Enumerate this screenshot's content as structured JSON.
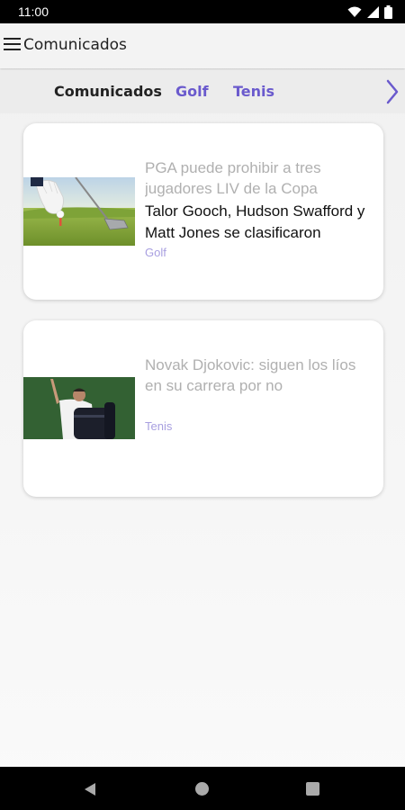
{
  "status_bar": {
    "time": "11:00",
    "icons": [
      "wifi-icon",
      "cellular-icon",
      "battery-icon"
    ]
  },
  "app_bar": {
    "title": "Comunicados",
    "menu_icon": "menu-icon"
  },
  "tabs": [
    {
      "label": "Comunicados",
      "active": true
    },
    {
      "label": "Golf",
      "active": false
    },
    {
      "label": "Tenis",
      "active": false
    }
  ],
  "tabs_next_icon": "chevron-right-icon",
  "articles": [
    {
      "headline": "PGA puede prohibir a tres jugadores LIV de la Copa",
      "subline": "Talor Gooch, Hudson Swafford y Matt Jones se clasificaron",
      "category": "Golf",
      "image": "golf-club-and-ball-photo"
    },
    {
      "headline": "Novak Djokovic: siguen los líos en su carrera por no",
      "subline": "",
      "category": "Tenis",
      "image": "tennis-player-waving-photo"
    }
  ],
  "colors": {
    "accent": "#6a5acd",
    "category": "#a89fe0",
    "headline_gray": "#b0b0b0"
  },
  "nav_bar": {
    "icons": [
      "back-icon",
      "home-icon",
      "recents-icon"
    ]
  }
}
